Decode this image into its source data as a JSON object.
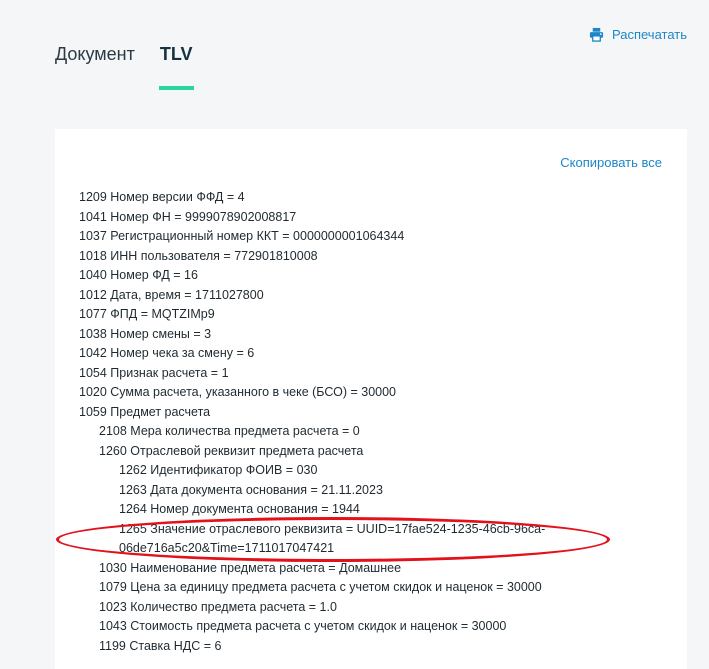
{
  "tabs": [
    {
      "label": "Документ",
      "active": false
    },
    {
      "label": "TLV",
      "active": true
    }
  ],
  "print_label": "Распечатать",
  "copy_all_label": "Скопировать все",
  "accent_color": "#2bd69b",
  "link_color": "#1d86c8",
  "highlight_color": "#e3111a",
  "tlv_lines": [
    {
      "level": 0,
      "text": "1209 Номер версии ФФД = 4"
    },
    {
      "level": 0,
      "text": "1041 Номер ФН = 9999078902008817"
    },
    {
      "level": 0,
      "text": "1037 Регистрационный номер ККТ = 0000000001064344"
    },
    {
      "level": 0,
      "text": "1018 ИНН пользователя = 772901810008"
    },
    {
      "level": 0,
      "text": "1040 Номер ФД = 16"
    },
    {
      "level": 0,
      "text": "1012 Дата, время = 1711027800"
    },
    {
      "level": 0,
      "text": "1077 ФПД = MQTZIMp9"
    },
    {
      "level": 0,
      "text": "1038 Номер смены = 3"
    },
    {
      "level": 0,
      "text": "1042 Номер чека за смену = 6"
    },
    {
      "level": 0,
      "text": "1054 Признак расчета = 1"
    },
    {
      "level": 0,
      "text": "1020 Сумма расчета, указанного в чеке (БСО) = 30000"
    },
    {
      "level": 0,
      "text": "1059 Предмет расчета"
    },
    {
      "level": 1,
      "text": "2108 Мера количества предмета расчета = 0"
    },
    {
      "level": 1,
      "text": "1260 Отраслевой реквизит предмета расчета"
    },
    {
      "level": 2,
      "text": "1262 Идентификатор ФОИВ = 030"
    },
    {
      "level": 2,
      "text": "1263 Дата документа основания = 21.11.2023"
    },
    {
      "level": 2,
      "text": "1264 Номер документа основания = 1944"
    },
    {
      "level": 2,
      "text": "1265 Значение отраслевого реквизита = UUID=17fae524-1235-46cb-96ca-06de716a5c20&Time=1711017047421",
      "wrap": true
    },
    {
      "level": 1,
      "text": "1030 Наименование предмета расчета = Домашнее"
    },
    {
      "level": 1,
      "text": "1079 Цена за единицу предмета расчета с учетом скидок и наценок = 30000"
    },
    {
      "level": 1,
      "text": "1023 Количество предмета расчета = 1.0"
    },
    {
      "level": 1,
      "text": "1043 Стоимость предмета расчета с учетом скидок и наценок = 30000"
    },
    {
      "level": 1,
      "text": "1199 Ставка НДС = 6"
    }
  ]
}
